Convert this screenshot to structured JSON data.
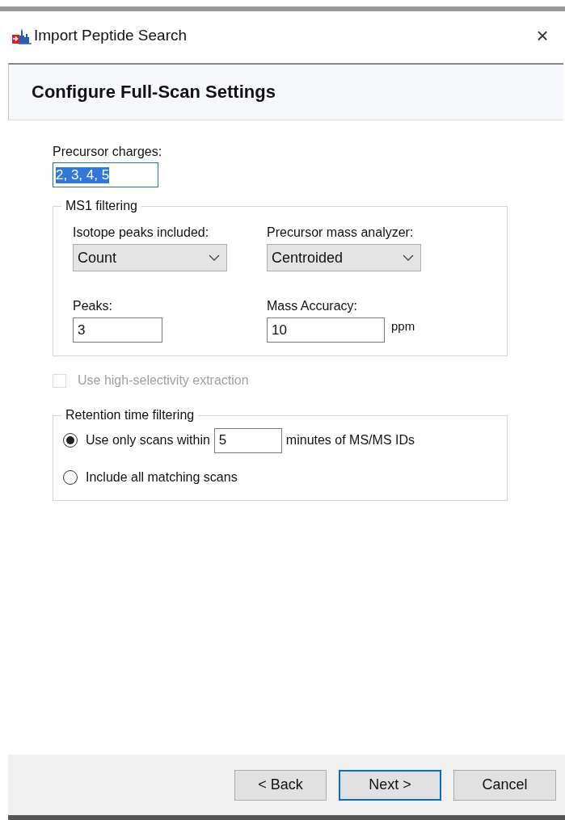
{
  "window": {
    "title": "Import Peptide Search",
    "close": "×"
  },
  "header": {
    "title": "Configure Full-Scan Settings"
  },
  "precursor_charges": {
    "label": "Precursor charges:",
    "value": "2, 3, 4, 5",
    "text_selected": true
  },
  "ms1_filtering": {
    "title": "MS1 filtering",
    "fields": [
      {
        "kind": "combo",
        "label": "Isotope peaks included:",
        "value": "Count"
      },
      {
        "kind": "combo",
        "label": "Precursor mass analyzer:",
        "value": "Centroided"
      },
      {
        "kind": "text",
        "label": "Peaks:",
        "value": "3"
      },
      {
        "kind": "text",
        "label": "Mass Accuracy:",
        "value": "10",
        "unit": "ppm"
      }
    ]
  },
  "high_selectivity": {
    "label": "Use high-selectivity extraction",
    "checked": false,
    "disabled": true
  },
  "retention_time_filtering": {
    "title": "Retention time filtering",
    "options": [
      {
        "label": "Use only scans within",
        "value": "5",
        "suffix": "minutes of MS/MS IDs",
        "selected": true
      },
      {
        "label": "Include all matching scans",
        "selected": false
      }
    ]
  },
  "buttons": [
    {
      "label": "< Back",
      "default": false
    },
    {
      "label": "Next >",
      "default": true
    },
    {
      "label": "Cancel",
      "default": false
    }
  ]
}
